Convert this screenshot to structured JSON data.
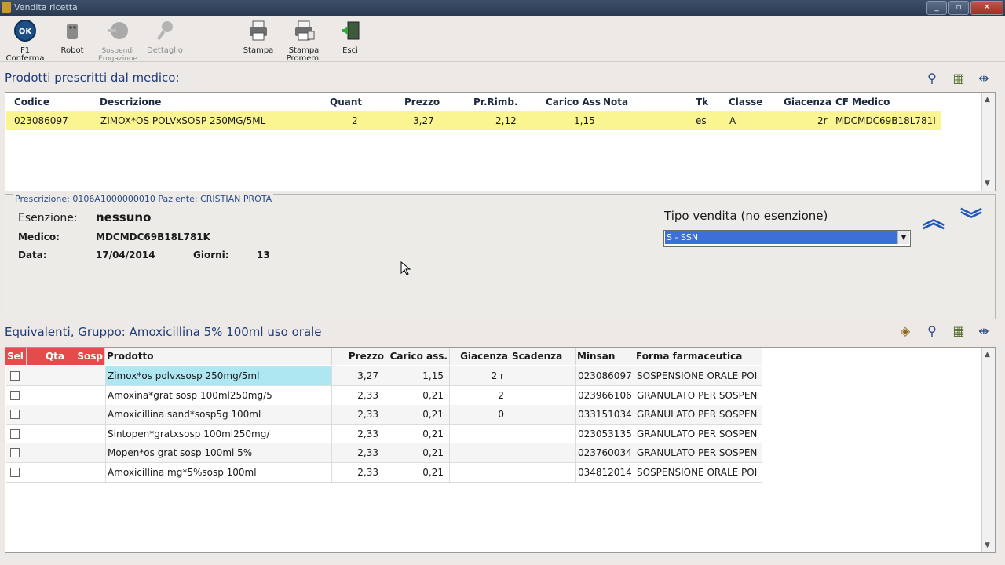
{
  "window": {
    "title": "Vendita ricetta"
  },
  "toolbar": {
    "buttons": [
      {
        "label": "F1\nConferma",
        "icon": "ok-icon"
      },
      {
        "label": "Robot",
        "icon": "robot-icon"
      },
      {
        "label": "Sospendi\nErogazione",
        "icon": "suspend-icon"
      },
      {
        "label": "Dettaglio",
        "icon": "detail-icon"
      },
      {
        "label": "Stampa",
        "icon": "printer-icon"
      },
      {
        "label": "Stampa\nPromem.",
        "icon": "printer-memo-icon"
      },
      {
        "label": "Esci",
        "icon": "exit-icon"
      }
    ]
  },
  "prescribed": {
    "title": "Prodotti prescritti dal medico:",
    "columns": [
      "Codice",
      "Descrizione",
      "Quant",
      "Prezzo",
      "Pr.Rimb.",
      "Carico Ass",
      "Nota",
      "Tk",
      "Classe",
      "Giacenza",
      "CF Medico"
    ],
    "rows": [
      {
        "codice": "023086097",
        "descrizione": "ZIMOX*OS POLVxSOSP 250MG/5ML",
        "quant": "2",
        "prezzo": "3,27",
        "prrimb": "2,12",
        "carico": "1,15",
        "nota": "",
        "tk": "es",
        "classe": "A",
        "giacenza": "2r",
        "cf": "MDCMDC69B18L781I"
      }
    ]
  },
  "detail": {
    "legend": "Prescrizione: 0106A1000000010 Paziente: CRISTIAN PROTA",
    "esenzione_label": "Esenzione:",
    "esenzione_value": "nessuno",
    "medico_label": "Medico:",
    "medico_value": "MDCMDC69B18L781K",
    "data_label": "Data:",
    "data_value": "17/04/2014",
    "giorni_label": "Giorni:",
    "giorni_value": "13",
    "tipo_vendita_label": "Tipo vendita (no esenzione)",
    "tipo_vendita_value": "S - SSN"
  },
  "equivalents": {
    "title": "Equivalenti, Gruppo: Amoxicillina 5% 100ml uso orale",
    "columns": [
      "Sel",
      "Qta",
      "Sosp",
      "Prodotto",
      "Prezzo",
      "Carico ass.",
      "Giacenza",
      "Scadenza",
      "Minsan",
      "Forma farmaceutica"
    ],
    "rows": [
      {
        "prodotto": "Zimox*os polvxsosp 250mg/5ml",
        "prezzo": "3,27",
        "carico": "1,15",
        "giacenza": "2 r",
        "scadenza": "",
        "minsan": "023086097",
        "forma": "SOSPENSIONE ORALE POI"
      },
      {
        "prodotto": "Amoxina*grat sosp 100ml250mg/5",
        "prezzo": "2,33",
        "carico": "0,21",
        "giacenza": "2",
        "scadenza": "",
        "minsan": "023966106",
        "forma": "GRANULATO PER SOSPEN"
      },
      {
        "prodotto": "Amoxicillina sand*sosp5g 100ml",
        "prezzo": "2,33",
        "carico": "0,21",
        "giacenza": "0",
        "scadenza": "",
        "minsan": "033151034",
        "forma": "GRANULATO PER SOSPEN"
      },
      {
        "prodotto": "Sintopen*gratxsosp 100ml250mg/",
        "prezzo": "2,33",
        "carico": "0,21",
        "giacenza": "",
        "scadenza": "",
        "minsan": "023053135",
        "forma": "GRANULATO PER SOSPEN"
      },
      {
        "prodotto": "Mopen*os grat sosp 100ml 5%",
        "prezzo": "2,33",
        "carico": "0,21",
        "giacenza": "",
        "scadenza": "",
        "minsan": "023760034",
        "forma": "GRANULATO PER SOSPEN"
      },
      {
        "prodotto": "Amoxicillina mg*5%sosp 100ml",
        "prezzo": "2,33",
        "carico": "0,21",
        "giacenza": "",
        "scadenza": "",
        "minsan": "034812014",
        "forma": "SOSPENSIONE ORALE POI"
      }
    ]
  },
  "colors": {
    "highlight_row": "#fbf591",
    "selected_cell": "#aee6f2",
    "sel_header": "#e64b4b",
    "accent": "#1e3a78"
  }
}
